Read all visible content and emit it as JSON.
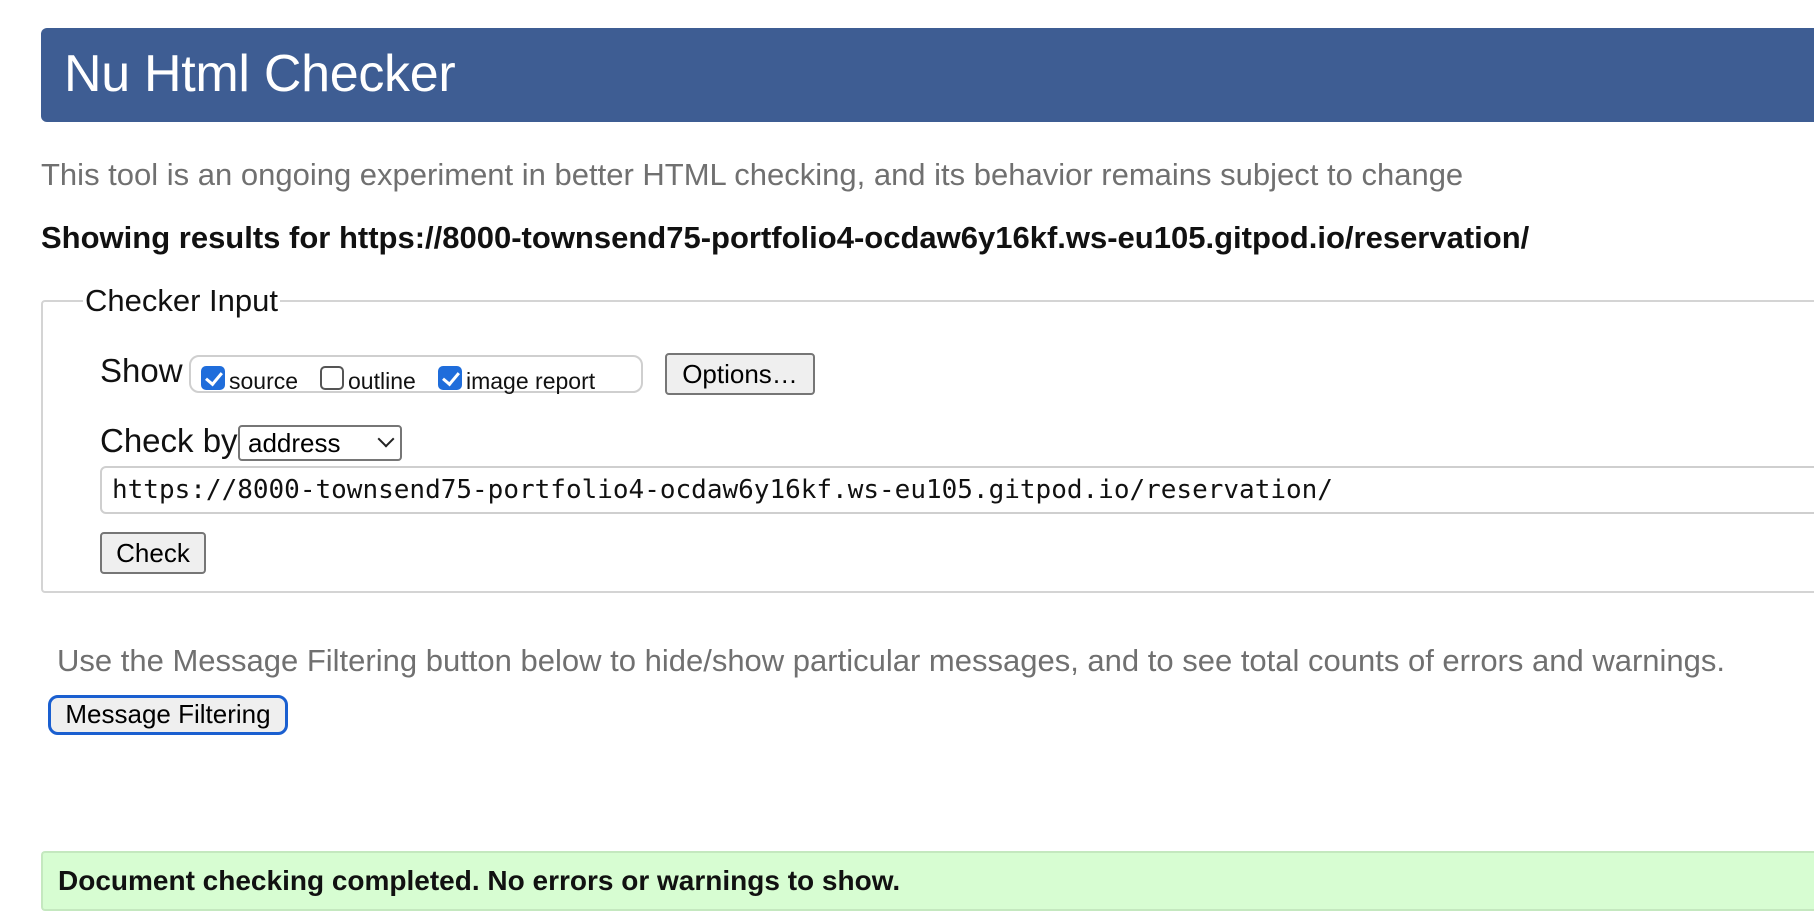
{
  "header": {
    "title": "Nu Html Checker"
  },
  "intro": "This tool is an ongoing experiment in better HTML checking, and its behavior remains subject to change",
  "results_heading": "Showing results for https://8000-townsend75-portfolio4-ocdaw6y16kf.ws-eu105.gitpod.io/reservation/",
  "checker_input": {
    "legend": "Checker Input",
    "show_label": "Show",
    "show_options": [
      {
        "label": "source",
        "checked": true
      },
      {
        "label": "outline",
        "checked": false
      },
      {
        "label": "image report",
        "checked": true
      }
    ],
    "options_button": "Options…",
    "check_by_label": "Check by",
    "check_by_selected": "address",
    "url_value": "https://8000-townsend75-portfolio4-ocdaw6y16kf.ws-eu105.gitpod.io/reservation/",
    "check_button": "Check"
  },
  "filter_note": "Use the Message Filtering button below to hide/show particular messages, and to see total counts of errors and warnings.",
  "filter_button": "Message Filtering",
  "status_message": "Document checking completed. No errors or warnings to show.",
  "colors": {
    "header_bg": "#3e5d93",
    "success_bg": "#d7fdd2",
    "checkbox_checked": "#1f6ddb",
    "focus_ring": "#1a5fd0"
  }
}
